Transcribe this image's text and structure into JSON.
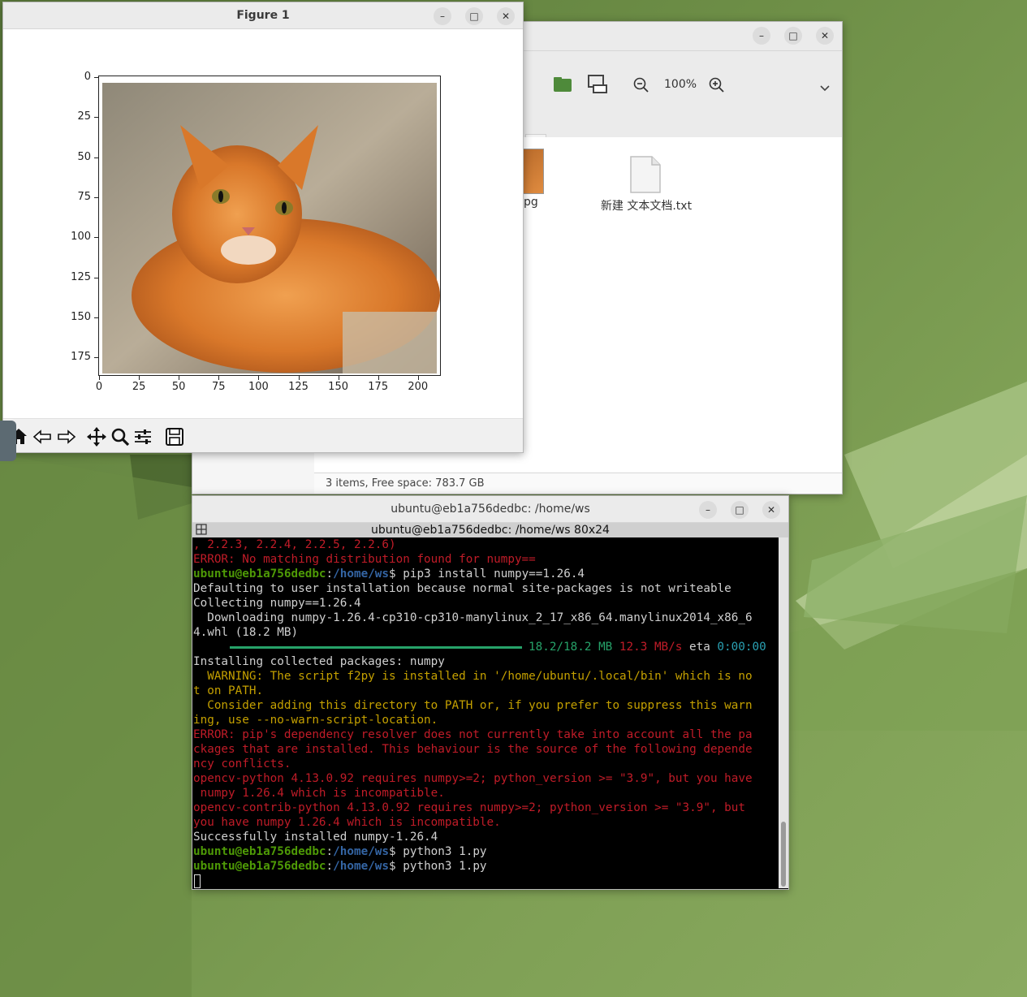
{
  "figure": {
    "title": "Figure 1",
    "y_ticks": [
      "0",
      "25",
      "50",
      "75",
      "100",
      "125",
      "150",
      "175"
    ],
    "x_ticks": [
      "0",
      "25",
      "50",
      "75",
      "100",
      "125",
      "150",
      "175",
      "200"
    ],
    "image_alt": "orange tabby cat"
  },
  "files": {
    "zoom": "100%",
    "partial_label": "pg",
    "text_file": "新建 文本文档.txt",
    "status": "3 items, Free space: 783.7 GB"
  },
  "terminal": {
    "title": "ubuntu@eb1a756dedbc: /home/ws",
    "tab_title": "ubuntu@eb1a756dedbc: /home/ws 80x24",
    "prompt_user": "ubuntu@eb1a756dedbc",
    "prompt_path": "/home/ws",
    "lines": [
      ", 2.2.3, 2.2.4, 2.2.5, 2.2.6)",
      "ERROR: No matching distribution found for numpy==",
      "pip3 install numpy==1.26.4",
      "Defaulting to user installation because normal site-packages is not writeable",
      "Collecting numpy==1.26.4",
      "  Downloading numpy-1.26.4-cp310-cp310-manylinux_2_17_x86_64.manylinux2014_x86_6",
      "4.whl (18.2 MB)",
      "Installing collected packages: numpy",
      "  WARNING: The script f2py is installed in '/home/ubuntu/.local/bin' which is no",
      "t on PATH.",
      "  Consider adding this directory to PATH or, if you prefer to suppress this warn",
      "ing, use --no-warn-script-location.",
      "ERROR: pip's dependency resolver does not currently take into account all the pa",
      "ckages that are installed. This behaviour is the source of the following depende",
      "ncy conflicts.",
      "opencv-python 4.13.0.92 requires numpy>=2; python_version >= \"3.9\", but you have",
      " numpy 1.26.4 which is incompatible.",
      "opencv-contrib-python 4.13.0.92 requires numpy>=2; python_version >= \"3.9\", but",
      "you have numpy 1.26.4 which is incompatible.",
      "Successfully installed numpy-1.26.4",
      "python3 1.py",
      "python3 1.py"
    ],
    "progress": {
      "size": "18.2/18.2 MB",
      "speed": "12.3 MB/s",
      "eta_label": "eta",
      "eta": "0:00:00",
      "fraction": 1.0
    }
  }
}
